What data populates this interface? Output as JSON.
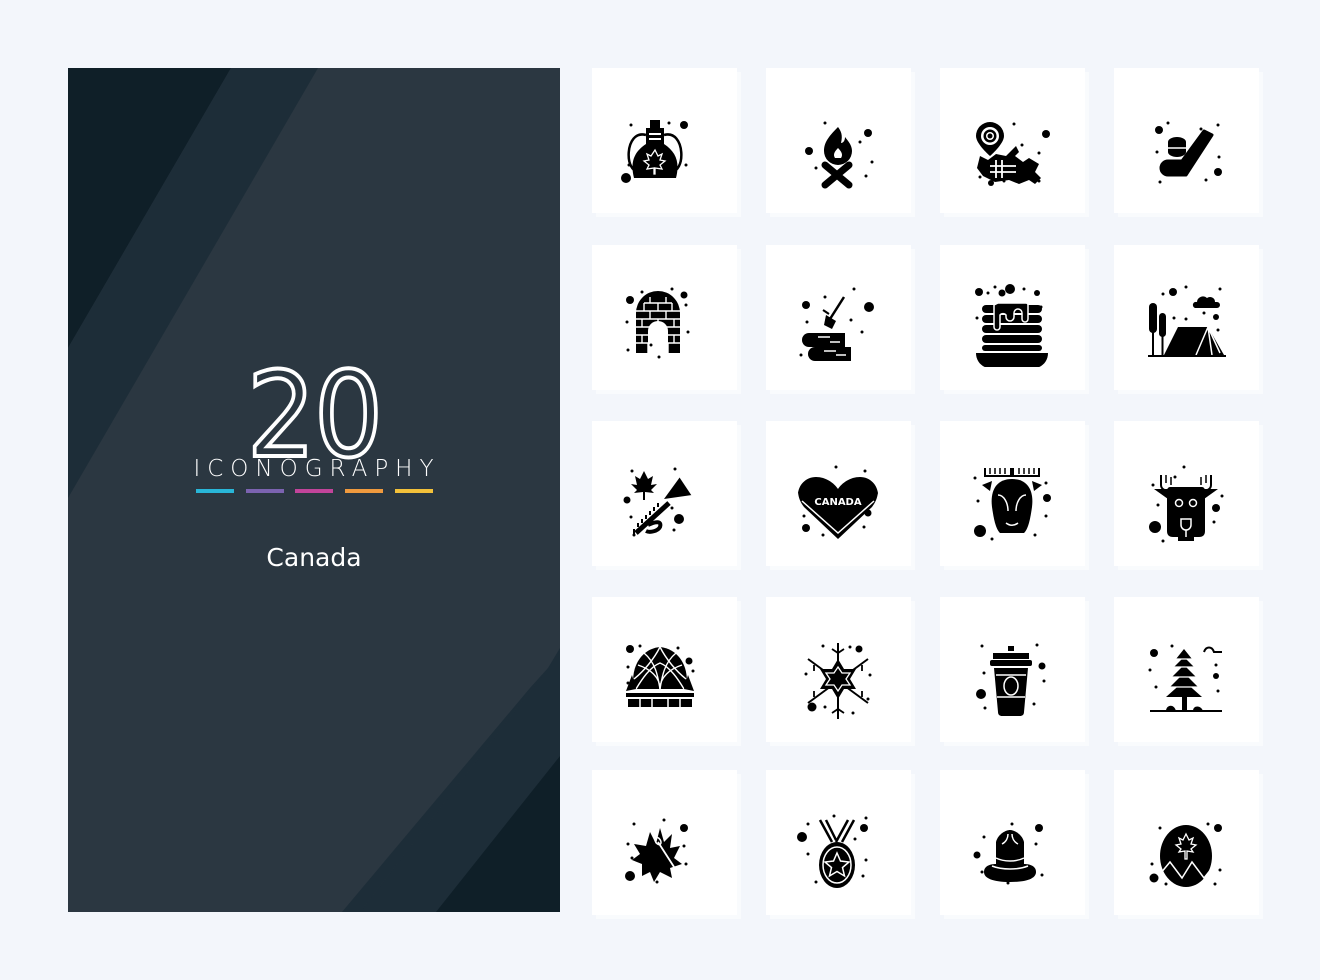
{
  "cover": {
    "count": "20",
    "kicker": "ICONOGRAPHY",
    "title": "Canada",
    "accent_colors": [
      "#29b6d8",
      "#7b63b0",
      "#c2449a",
      "#f09a3e",
      "#f3c13a"
    ],
    "background_colors": {
      "panel": "#2b3741",
      "stripe_dark": "#0f1f28",
      "stripe_mid": "#1d2d38"
    }
  },
  "page_background": "#f3f6fb",
  "icons": [
    {
      "name": "maple-syrup-jug-icon"
    },
    {
      "name": "campfire-icon"
    },
    {
      "name": "canada-map-pin-icon"
    },
    {
      "name": "hockey-stick-puck-icon"
    },
    {
      "name": "igloo-icon"
    },
    {
      "name": "axe-logs-icon"
    },
    {
      "name": "pancakes-syrup-icon"
    },
    {
      "name": "camping-tent-icon"
    },
    {
      "name": "maple-trumpet-icon"
    },
    {
      "name": "canada-heart-icon",
      "label": "CANADA"
    },
    {
      "name": "moose-face-icon"
    },
    {
      "name": "reindeer-face-icon"
    },
    {
      "name": "biosphere-dome-icon"
    },
    {
      "name": "snowflake-icon"
    },
    {
      "name": "coffee-cup-icon"
    },
    {
      "name": "pine-tree-icon"
    },
    {
      "name": "maple-leaf-needle-icon"
    },
    {
      "name": "star-medal-icon"
    },
    {
      "name": "mountie-hat-icon"
    },
    {
      "name": "maple-mountain-badge-icon"
    }
  ]
}
